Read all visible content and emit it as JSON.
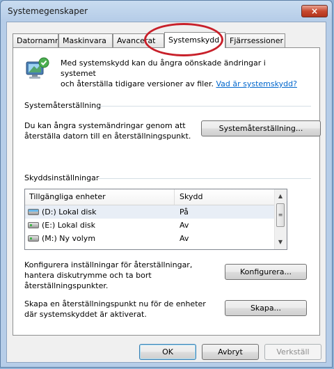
{
  "window": {
    "title": "Systemegenskaper",
    "close_glyph": "×"
  },
  "tabs": [
    {
      "label": "Datornamn"
    },
    {
      "label": "Maskinvara"
    },
    {
      "label": "Avancerat"
    },
    {
      "label": "Systemskydd"
    },
    {
      "label": "Fjärrsessioner"
    }
  ],
  "intro": {
    "line1": "Med systemskydd kan du ångra oönskade ändringar i systemet",
    "line2": "och återställa tidigare versioner av filer. ",
    "link": "Vad är systemskydd?"
  },
  "restore": {
    "title": "Systemåterställning",
    "line1": "Du kan ångra systemändringar genom att",
    "line2": "återställa datorn till en återställningspunkt.",
    "button": "Systemåterställning..."
  },
  "protection": {
    "title": "Skyddsinställningar",
    "columns": [
      "Tillgängliga enheter",
      "Skydd"
    ],
    "rows": [
      {
        "drive": "(D:) Lokal disk",
        "status": "På"
      },
      {
        "drive": "(E:) Lokal disk",
        "status": "Av"
      },
      {
        "drive": "(M:) Ny volym",
        "status": "Av"
      }
    ],
    "configure_line1": "Konfigurera inställningar för återställningar,",
    "configure_line2": "hantera diskutrymme och ta bort",
    "configure_line3": "återställningspunkter.",
    "configure_button": "Konfigurera...",
    "create_line1": "Skapa en återställningspunkt nu för de enheter",
    "create_line2": "där systemskyddet är aktiverat.",
    "create_button": "Skapa..."
  },
  "footer": {
    "ok": "OK",
    "cancel": "Avbryt",
    "apply": "Verkställ"
  },
  "colors": {
    "highlight": "#c8202a",
    "link": "#0066cc"
  }
}
